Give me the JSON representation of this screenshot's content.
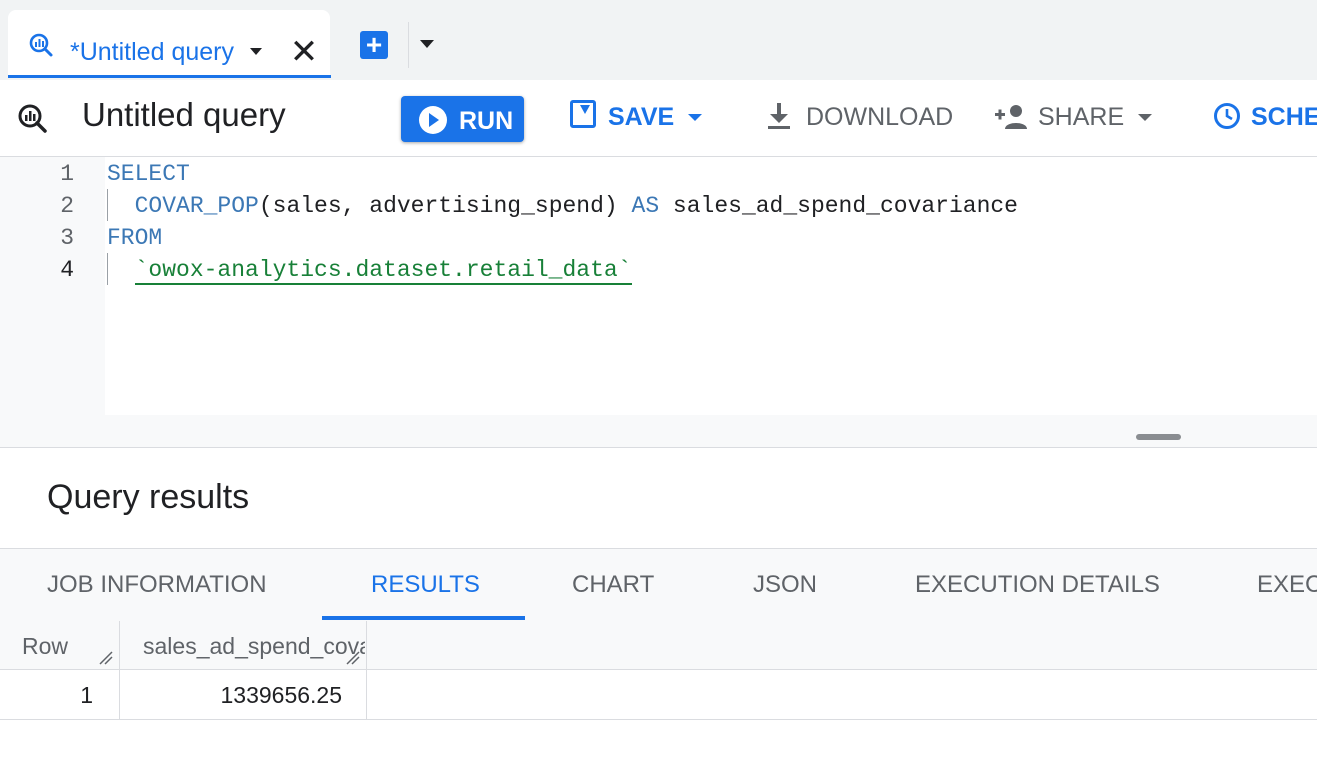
{
  "tab_bar": {
    "active_tab_label": "*Untitled query",
    "close_glyph": "✕",
    "new_tab_glyph": "+"
  },
  "toolbar": {
    "query_title": "Untitled query",
    "run_label": "RUN",
    "save_label": "SAVE",
    "download_label": "DOWNLOAD",
    "share_label": "SHARE",
    "schedule_label": "SCHE"
  },
  "editor": {
    "lines": [
      {
        "number": "1",
        "tokens": [
          {
            "t": "SELECT",
            "cls": "kw"
          }
        ]
      },
      {
        "number": "2",
        "tokens": [
          {
            "t": "  ",
            "cls": "plain"
          },
          {
            "t": "COVAR_POP",
            "cls": "fn"
          },
          {
            "t": "(sales, advertising_spend) ",
            "cls": "plain"
          },
          {
            "t": "AS",
            "cls": "kw"
          },
          {
            "t": " sales_ad_spend_covariance",
            "cls": "plain"
          }
        ]
      },
      {
        "number": "3",
        "tokens": [
          {
            "t": "FROM",
            "cls": "kw"
          }
        ]
      },
      {
        "number": "4",
        "tokens": [
          {
            "t": "  ",
            "cls": "plain"
          },
          {
            "t": "`owox-analytics.dataset.retail_data`",
            "cls": "str"
          }
        ]
      }
    ]
  },
  "results": {
    "title": "Query results",
    "tabs": [
      {
        "label": "JOB INFORMATION",
        "active": false
      },
      {
        "label": "RESULTS",
        "active": true
      },
      {
        "label": "CHART",
        "active": false
      },
      {
        "label": "JSON",
        "active": false
      },
      {
        "label": "EXECUTION DETAILS",
        "active": false
      },
      {
        "label": "EXEC",
        "active": false
      }
    ],
    "columns": [
      "Row",
      "sales_ad_spend_covariance"
    ],
    "rows": [
      {
        "row": "1",
        "value": "1339656.25"
      }
    ]
  },
  "colors": {
    "accent": "#1a73e8",
    "keyword": "#3c78b5",
    "string": "#188038"
  }
}
